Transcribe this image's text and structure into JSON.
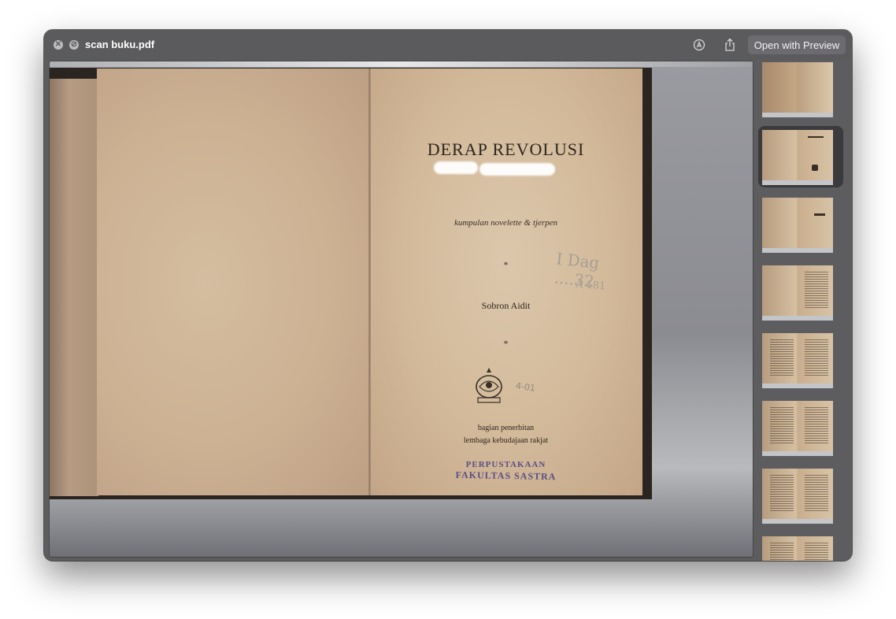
{
  "window": {
    "title": "scan buku.pdf",
    "open_button_label": "Open with Preview"
  },
  "book": {
    "title": "DERAP REVOLUSI",
    "subtitle": "kumpulan novelette & tjerpen",
    "star1": "*",
    "author": "Sobron Aidit",
    "star2": "*",
    "publisher_line1": "bagian penerbitan",
    "publisher_line2": "lembaga kebudajaan rakjat",
    "stamp_line1": "PERPUSTAKAAN",
    "stamp_line2": "FAKULTAS SASTRA",
    "pencil_note": "I Dag ....32",
    "pencil_note2": "A 181",
    "pencil_note3": "4-01"
  },
  "thumbnails": {
    "count": 8,
    "selected_index": 1
  },
  "colors": {
    "window_bg": "#5d5d60",
    "page_paper": "#d2b999",
    "stamp_ink": "#5a4f86"
  },
  "icons": [
    "close-icon",
    "disabled-icon",
    "markup-icon",
    "share-icon"
  ]
}
